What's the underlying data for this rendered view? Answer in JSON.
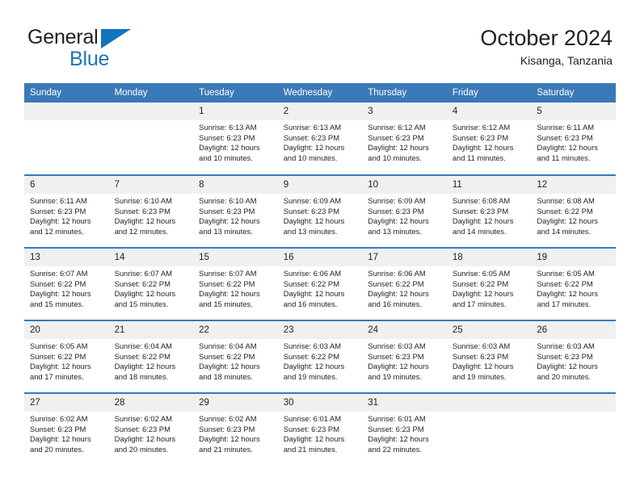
{
  "brand": {
    "line1": "General",
    "line2": "Blue",
    "triangle_icon": "triangle-icon",
    "accent_color": "#1b75bb"
  },
  "header": {
    "title": "October 2024",
    "subtitle": "Kisanga, Tanzania",
    "header_bg_color": "#3a79b8",
    "daynum_bg_color": "#f0f0f0"
  },
  "weekday_headers": [
    "Sunday",
    "Monday",
    "Tuesday",
    "Wednesday",
    "Thursday",
    "Friday",
    "Saturday"
  ],
  "weeks": [
    [
      {
        "day": "",
        "sunrise": "",
        "sunset": "",
        "daylight1": "",
        "daylight2": "",
        "empty": true
      },
      {
        "day": "",
        "sunrise": "",
        "sunset": "",
        "daylight1": "",
        "daylight2": "",
        "empty": true
      },
      {
        "day": "1",
        "sunrise": "Sunrise: 6:13 AM",
        "sunset": "Sunset: 6:23 PM",
        "daylight1": "Daylight: 12 hours",
        "daylight2": "and 10 minutes."
      },
      {
        "day": "2",
        "sunrise": "Sunrise: 6:13 AM",
        "sunset": "Sunset: 6:23 PM",
        "daylight1": "Daylight: 12 hours",
        "daylight2": "and 10 minutes."
      },
      {
        "day": "3",
        "sunrise": "Sunrise: 6:12 AM",
        "sunset": "Sunset: 6:23 PM",
        "daylight1": "Daylight: 12 hours",
        "daylight2": "and 10 minutes."
      },
      {
        "day": "4",
        "sunrise": "Sunrise: 6:12 AM",
        "sunset": "Sunset: 6:23 PM",
        "daylight1": "Daylight: 12 hours",
        "daylight2": "and 11 minutes."
      },
      {
        "day": "5",
        "sunrise": "Sunrise: 6:11 AM",
        "sunset": "Sunset: 6:23 PM",
        "daylight1": "Daylight: 12 hours",
        "daylight2": "and 11 minutes."
      }
    ],
    [
      {
        "day": "6",
        "sunrise": "Sunrise: 6:11 AM",
        "sunset": "Sunset: 6:23 PM",
        "daylight1": "Daylight: 12 hours",
        "daylight2": "and 12 minutes."
      },
      {
        "day": "7",
        "sunrise": "Sunrise: 6:10 AM",
        "sunset": "Sunset: 6:23 PM",
        "daylight1": "Daylight: 12 hours",
        "daylight2": "and 12 minutes."
      },
      {
        "day": "8",
        "sunrise": "Sunrise: 6:10 AM",
        "sunset": "Sunset: 6:23 PM",
        "daylight1": "Daylight: 12 hours",
        "daylight2": "and 13 minutes."
      },
      {
        "day": "9",
        "sunrise": "Sunrise: 6:09 AM",
        "sunset": "Sunset: 6:23 PM",
        "daylight1": "Daylight: 12 hours",
        "daylight2": "and 13 minutes."
      },
      {
        "day": "10",
        "sunrise": "Sunrise: 6:09 AM",
        "sunset": "Sunset: 6:23 PM",
        "daylight1": "Daylight: 12 hours",
        "daylight2": "and 13 minutes."
      },
      {
        "day": "11",
        "sunrise": "Sunrise: 6:08 AM",
        "sunset": "Sunset: 6:23 PM",
        "daylight1": "Daylight: 12 hours",
        "daylight2": "and 14 minutes."
      },
      {
        "day": "12",
        "sunrise": "Sunrise: 6:08 AM",
        "sunset": "Sunset: 6:22 PM",
        "daylight1": "Daylight: 12 hours",
        "daylight2": "and 14 minutes."
      }
    ],
    [
      {
        "day": "13",
        "sunrise": "Sunrise: 6:07 AM",
        "sunset": "Sunset: 6:22 PM",
        "daylight1": "Daylight: 12 hours",
        "daylight2": "and 15 minutes."
      },
      {
        "day": "14",
        "sunrise": "Sunrise: 6:07 AM",
        "sunset": "Sunset: 6:22 PM",
        "daylight1": "Daylight: 12 hours",
        "daylight2": "and 15 minutes."
      },
      {
        "day": "15",
        "sunrise": "Sunrise: 6:07 AM",
        "sunset": "Sunset: 6:22 PM",
        "daylight1": "Daylight: 12 hours",
        "daylight2": "and 15 minutes."
      },
      {
        "day": "16",
        "sunrise": "Sunrise: 6:06 AM",
        "sunset": "Sunset: 6:22 PM",
        "daylight1": "Daylight: 12 hours",
        "daylight2": "and 16 minutes."
      },
      {
        "day": "17",
        "sunrise": "Sunrise: 6:06 AM",
        "sunset": "Sunset: 6:22 PM",
        "daylight1": "Daylight: 12 hours",
        "daylight2": "and 16 minutes."
      },
      {
        "day": "18",
        "sunrise": "Sunrise: 6:05 AM",
        "sunset": "Sunset: 6:22 PM",
        "daylight1": "Daylight: 12 hours",
        "daylight2": "and 17 minutes."
      },
      {
        "day": "19",
        "sunrise": "Sunrise: 6:05 AM",
        "sunset": "Sunset: 6:22 PM",
        "daylight1": "Daylight: 12 hours",
        "daylight2": "and 17 minutes."
      }
    ],
    [
      {
        "day": "20",
        "sunrise": "Sunrise: 6:05 AM",
        "sunset": "Sunset: 6:22 PM",
        "daylight1": "Daylight: 12 hours",
        "daylight2": "and 17 minutes."
      },
      {
        "day": "21",
        "sunrise": "Sunrise: 6:04 AM",
        "sunset": "Sunset: 6:22 PM",
        "daylight1": "Daylight: 12 hours",
        "daylight2": "and 18 minutes."
      },
      {
        "day": "22",
        "sunrise": "Sunrise: 6:04 AM",
        "sunset": "Sunset: 6:22 PM",
        "daylight1": "Daylight: 12 hours",
        "daylight2": "and 18 minutes."
      },
      {
        "day": "23",
        "sunrise": "Sunrise: 6:03 AM",
        "sunset": "Sunset: 6:22 PM",
        "daylight1": "Daylight: 12 hours",
        "daylight2": "and 19 minutes."
      },
      {
        "day": "24",
        "sunrise": "Sunrise: 6:03 AM",
        "sunset": "Sunset: 6:23 PM",
        "daylight1": "Daylight: 12 hours",
        "daylight2": "and 19 minutes."
      },
      {
        "day": "25",
        "sunrise": "Sunrise: 6:03 AM",
        "sunset": "Sunset: 6:23 PM",
        "daylight1": "Daylight: 12 hours",
        "daylight2": "and 19 minutes."
      },
      {
        "day": "26",
        "sunrise": "Sunrise: 6:03 AM",
        "sunset": "Sunset: 6:23 PM",
        "daylight1": "Daylight: 12 hours",
        "daylight2": "and 20 minutes."
      }
    ],
    [
      {
        "day": "27",
        "sunrise": "Sunrise: 6:02 AM",
        "sunset": "Sunset: 6:23 PM",
        "daylight1": "Daylight: 12 hours",
        "daylight2": "and 20 minutes."
      },
      {
        "day": "28",
        "sunrise": "Sunrise: 6:02 AM",
        "sunset": "Sunset: 6:23 PM",
        "daylight1": "Daylight: 12 hours",
        "daylight2": "and 20 minutes."
      },
      {
        "day": "29",
        "sunrise": "Sunrise: 6:02 AM",
        "sunset": "Sunset: 6:23 PM",
        "daylight1": "Daylight: 12 hours",
        "daylight2": "and 21 minutes."
      },
      {
        "day": "30",
        "sunrise": "Sunrise: 6:01 AM",
        "sunset": "Sunset: 6:23 PM",
        "daylight1": "Daylight: 12 hours",
        "daylight2": "and 21 minutes."
      },
      {
        "day": "31",
        "sunrise": "Sunrise: 6:01 AM",
        "sunset": "Sunset: 6:23 PM",
        "daylight1": "Daylight: 12 hours",
        "daylight2": "and 22 minutes."
      },
      {
        "day": "",
        "sunrise": "",
        "sunset": "",
        "daylight1": "",
        "daylight2": "",
        "empty": true
      },
      {
        "day": "",
        "sunrise": "",
        "sunset": "",
        "daylight1": "",
        "daylight2": "",
        "empty": true
      }
    ]
  ]
}
